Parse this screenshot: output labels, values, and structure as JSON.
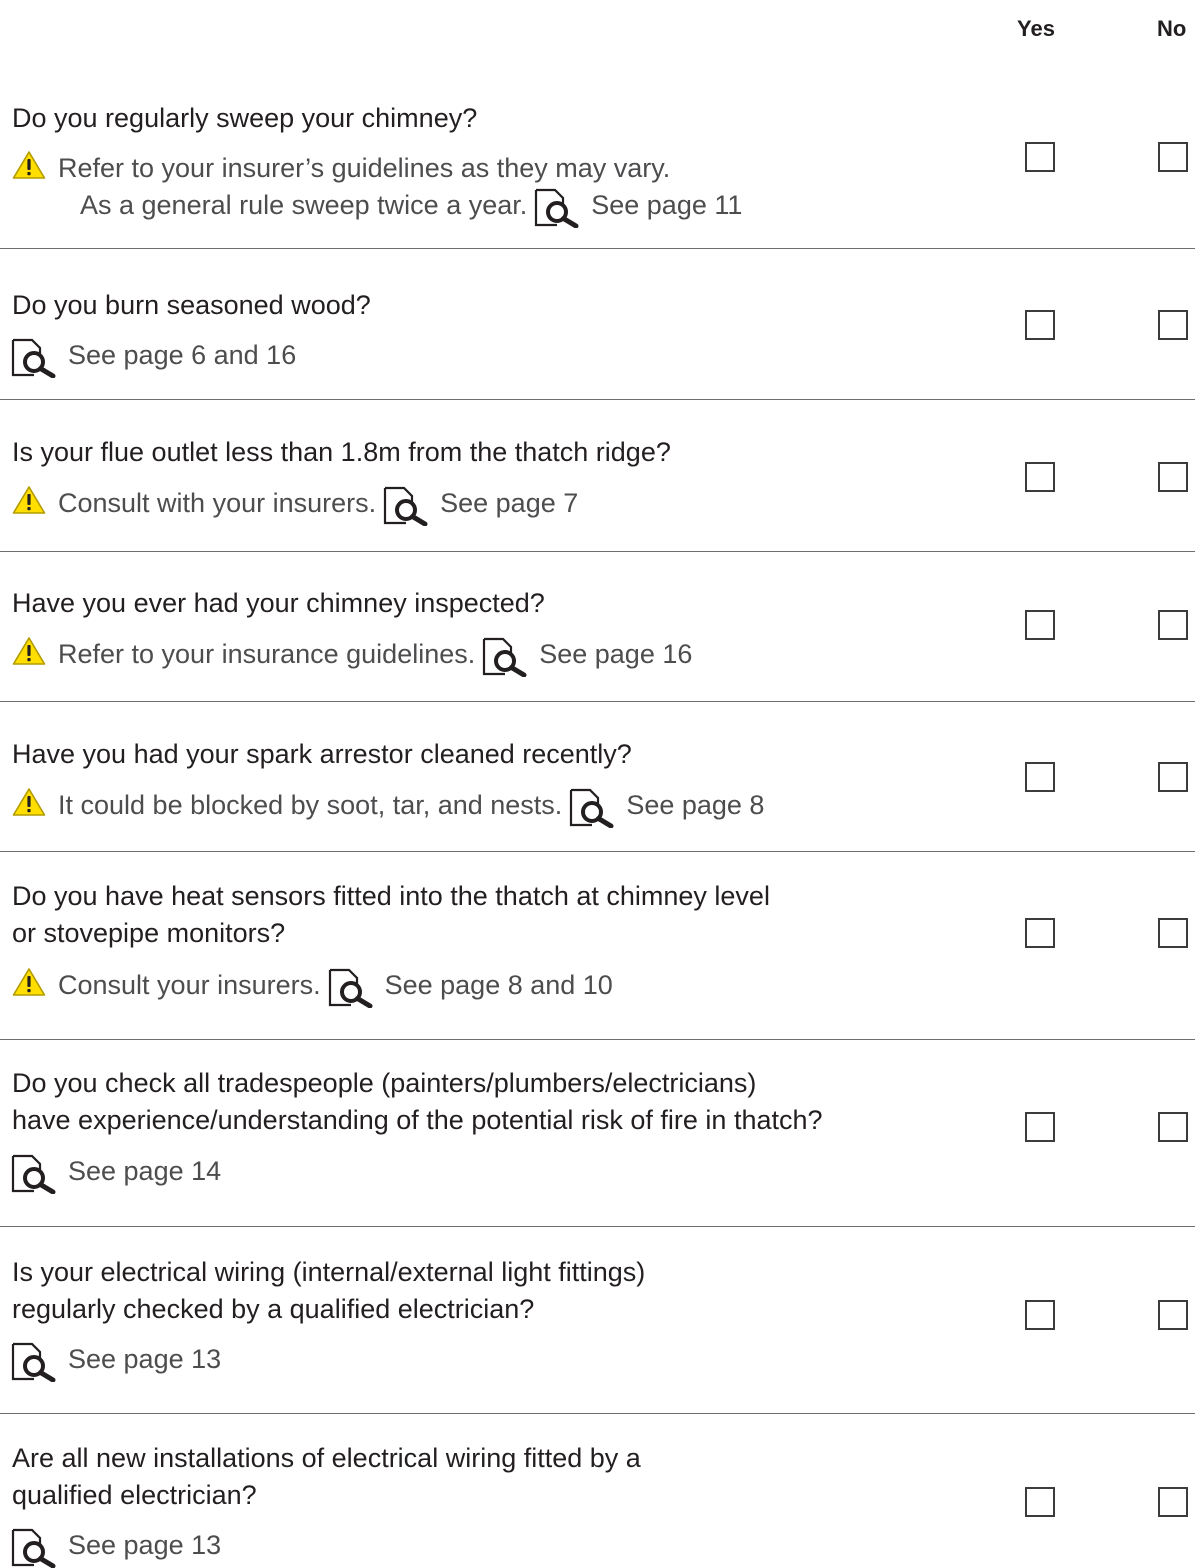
{
  "header": {
    "yes": "Yes",
    "no": "No"
  },
  "rows": [
    {
      "question": "Do you regularly sweep your chimney?",
      "warning": "Refer to your insurer’s guidelines as they may vary.",
      "extra": "As a general rule sweep twice a year.",
      "see": "See page 11"
    },
    {
      "question": "Do you burn seasoned wood?",
      "see": "See page 6 and 16"
    },
    {
      "question": "Is your flue outlet less than 1.8m from the thatch ridge?",
      "warning": "Consult with your insurers.",
      "see": "See page 7"
    },
    {
      "question": "Have you ever had your chimney inspected?",
      "warning": "Refer to your insurance guidelines.",
      "see": "See page 16"
    },
    {
      "question": "Have you had your spark arrestor cleaned recently?",
      "warning": "It could be blocked by soot, tar, and nests.",
      "see": "See page 8"
    },
    {
      "question_lines": [
        "Do you have heat sensors fitted into the thatch at chimney level",
        "or stovepipe monitors?"
      ],
      "warning": "Consult your insurers.",
      "see": "See page 8 and 10"
    },
    {
      "question_lines": [
        "Do you check all tradespeople (painters/plumbers/electricians)",
        "have experience/understanding of the potential risk of fire in thatch?"
      ],
      "see": "See page 14"
    },
    {
      "question_lines": [
        "Is your electrical wiring (internal/external light fittings)",
        "regularly checked by a qualified electrician?"
      ],
      "see": "See page 13"
    },
    {
      "question_lines": [
        "Are all new installations of electrical wiring fitted by a",
        "qualified electrician?"
      ],
      "see": "See page 13"
    }
  ],
  "icons": {
    "warning": "warning-triangle-icon",
    "reference": "page-magnifier-icon"
  },
  "colors": {
    "warning_fill": "#ffde00",
    "text": "#231f20",
    "note_text": "#4d4d4f",
    "rule": "#6d6e71"
  }
}
